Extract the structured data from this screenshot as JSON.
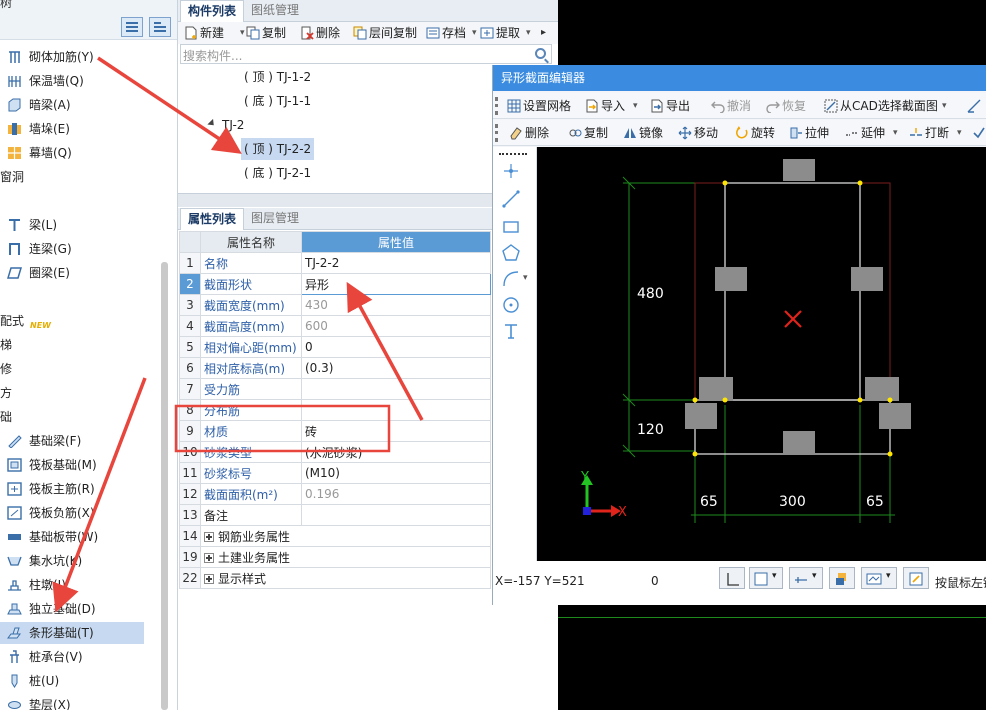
{
  "left_panel": {
    "title": "树",
    "items": [
      {
        "label": "砌体加筋(Y)",
        "icon": "masonry-rebar-icon"
      },
      {
        "label": "保温墙(Q)",
        "icon": "insulation-wall-icon"
      },
      {
        "label": "暗梁(A)",
        "icon": "hidden-beam-icon"
      },
      {
        "label": "墙垛(E)",
        "icon": "wall-pier-icon"
      },
      {
        "label": "幕墙(Q)",
        "icon": "curtain-wall-icon"
      },
      {
        "label": "窗洞",
        "icon": ""
      },
      {
        "label": "梁(L)",
        "icon": "beam-icon"
      },
      {
        "label": "连梁(G)",
        "icon": "coupling-beam-icon"
      },
      {
        "label": "圈梁(E)",
        "icon": "ring-beam-icon"
      },
      {
        "label": "配式",
        "icon": ""
      },
      {
        "label": "梯",
        "icon": ""
      },
      {
        "label": "修",
        "icon": ""
      },
      {
        "label": "方",
        "icon": ""
      },
      {
        "label": "础",
        "icon": ""
      },
      {
        "label": "基础梁(F)",
        "icon": "foundation-beam-icon"
      },
      {
        "label": "筏板基础(M)",
        "icon": "raft-foundation-icon"
      },
      {
        "label": "筏板主筋(R)",
        "icon": "raft-main-rebar-icon"
      },
      {
        "label": "筏板负筋(X)",
        "icon": "raft-negative-rebar-icon"
      },
      {
        "label": "基础板带(W)",
        "icon": "foundation-strip-icon"
      },
      {
        "label": "集水坑(K)",
        "icon": "sump-pit-icon"
      },
      {
        "label": "柱墩(I)",
        "icon": "column-pier-icon"
      },
      {
        "label": "独立基础(D)",
        "icon": "isolated-footing-icon"
      },
      {
        "label": "条形基础(T)",
        "icon": "strip-footing-icon"
      },
      {
        "label": "桩承台(V)",
        "icon": "pile-cap-icon"
      },
      {
        "label": "桩(U)",
        "icon": "pile-icon"
      },
      {
        "label": "垫层(X)",
        "icon": "cushion-layer-icon"
      }
    ],
    "new_badge": "NEW",
    "selected": "条形基础(T)"
  },
  "component_panel": {
    "tabs": [
      "构件列表",
      "图纸管理"
    ],
    "toolbar": {
      "new": "新建",
      "copy": "复制",
      "delete": "删除",
      "floor_copy": "层间复制",
      "save": "存档",
      "extract": "提取"
    },
    "search_placeholder": "搜索构件...",
    "tree": [
      {
        "label": "( 顶 ) TJ-1-2"
      },
      {
        "label": "( 底 ) TJ-1-1"
      },
      {
        "label": "TJ-2"
      },
      {
        "label": "( 顶 ) TJ-2-2"
      },
      {
        "label": "( 底 ) TJ-2-1"
      }
    ],
    "selected": "( 顶 ) TJ-2-2"
  },
  "property_panel": {
    "tabs": [
      "属性列表",
      "图层管理"
    ],
    "headers": {
      "name": "属性名称",
      "value": "属性值"
    },
    "rows": [
      {
        "num": "1",
        "name": "名称",
        "value": "TJ-2-2"
      },
      {
        "num": "2",
        "name": "截面形状",
        "value": "异形"
      },
      {
        "num": "3",
        "name": "截面宽度(mm)",
        "value": "430"
      },
      {
        "num": "4",
        "name": "截面高度(mm)",
        "value": "600"
      },
      {
        "num": "5",
        "name": "相对偏心距(mm)",
        "value": "0"
      },
      {
        "num": "6",
        "name": "相对底标高(m)",
        "value": "(0.3)"
      },
      {
        "num": "7",
        "name": "受力筋",
        "value": ""
      },
      {
        "num": "8",
        "name": "分布筋",
        "value": ""
      },
      {
        "num": "9",
        "name": "材质",
        "value": "砖"
      },
      {
        "num": "10",
        "name": "砂浆类型",
        "value": "(水泥砂浆)"
      },
      {
        "num": "11",
        "name": "砂浆标号",
        "value": "(M10)"
      },
      {
        "num": "12",
        "name": "截面面积(m²)",
        "value": "0.196"
      },
      {
        "num": "13",
        "name": "备注",
        "value": ""
      },
      {
        "num": "14",
        "name": "钢筋业务属性",
        "value": ""
      },
      {
        "num": "19",
        "name": "土建业务属性",
        "value": ""
      },
      {
        "num": "22",
        "name": "显示样式",
        "value": ""
      }
    ]
  },
  "editor": {
    "title": "异形截面编辑器",
    "toolbar1": {
      "grid": "设置网格",
      "import": "导入",
      "export": "导出",
      "undo": "撤消",
      "redo": "恢复",
      "from_cad": "从CAD选择截面图"
    },
    "toolbar2": {
      "delete": "删除",
      "copy": "复制",
      "mirror": "镜像",
      "move": "移动",
      "rotate": "旋转",
      "stretch": "拉伸",
      "extend": "延伸",
      "break": "打断"
    },
    "dimensions": {
      "top_height": "480",
      "bottom_height": "120",
      "left_width": "65",
      "middle_width": "300",
      "right_width": "65"
    },
    "axis": {
      "y": "Y",
      "x": "X"
    },
    "status": {
      "coords": "X=-157 Y=521",
      "value": "0",
      "hint": "按鼠标左键"
    }
  },
  "colors": {
    "accent": "#3b8ce0",
    "selection": "#c6d9f0",
    "annotation_red": "#e8453c",
    "dim_green": "#1e8a1e"
  }
}
